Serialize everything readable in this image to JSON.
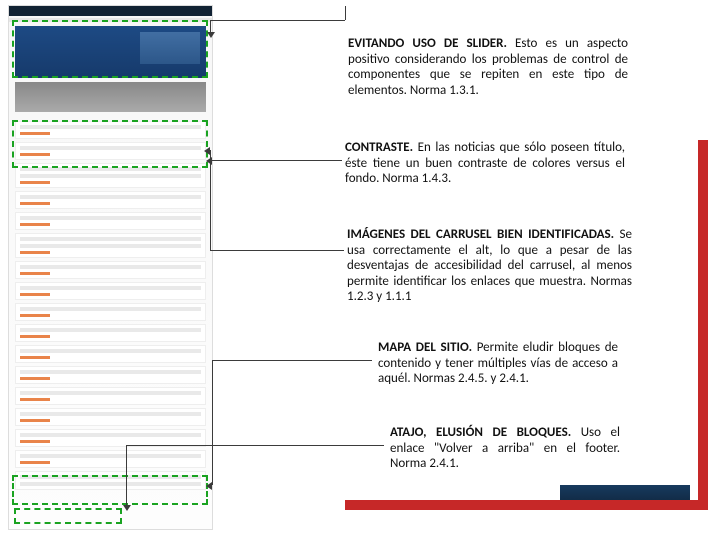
{
  "annotations": {
    "p1": {
      "lead": "EVITANDO USO DE SLIDER.",
      "body": " Esto es un aspecto positivo considerando los problemas de control de componentes que se repiten en este tipo de elementos. Norma 1.3.1."
    },
    "p2": {
      "lead": "CONTRASTE.",
      "body": " En las noticias que sólo poseen título, éste tiene un buen contraste de colores versus el fondo. Norma 1.4.3."
    },
    "p3": {
      "lead": "IMÁGENES DEL CARRUSEL BIEN IDENTIFICADAS.",
      "body": " Se usa correctamente el alt, lo que a pesar de las desventajas de accesibilidad del carrusel, al menos permite identificar los enlaces que muestra. Normas 1.2.3 y 1.1.1"
    },
    "p4": {
      "lead": "MAPA DEL SITIO.",
      "body": " Permite eludir bloques de contenido y tener múltiples vías de acceso a aquél. Normas 2.4.5. y 2.4.1."
    },
    "p5": {
      "lead": "ATAJO, ELUSIÓN DE BLOQUES.",
      "body": " Uso el enlace \"Volver a arriba\" en el footer. Norma 2.4.1."
    }
  }
}
